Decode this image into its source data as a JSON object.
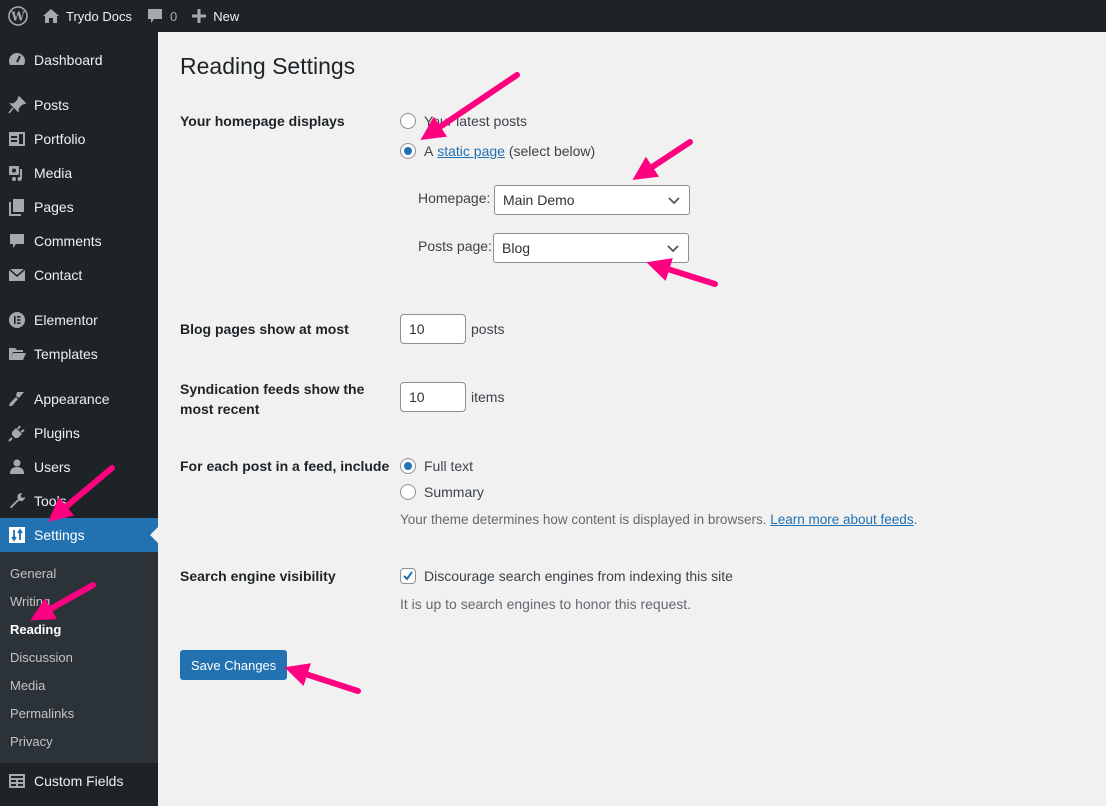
{
  "adminbar": {
    "wp_logo": "wordpress-logo",
    "site_name": "Trydo Docs",
    "comments_count": "0",
    "new_label": "New"
  },
  "sidebar": {
    "items": [
      {
        "label": "Dashboard",
        "icon": "dashboard-icon"
      },
      {
        "label": "Posts",
        "icon": "pin-icon"
      },
      {
        "label": "Portfolio",
        "icon": "portfolio-icon"
      },
      {
        "label": "Media",
        "icon": "media-icon"
      },
      {
        "label": "Pages",
        "icon": "pages-icon"
      },
      {
        "label": "Comments",
        "icon": "comment-icon"
      },
      {
        "label": "Contact",
        "icon": "envelope-icon"
      },
      {
        "label": "Elementor",
        "icon": "elementor-icon"
      },
      {
        "label": "Templates",
        "icon": "folder-icon"
      },
      {
        "label": "Appearance",
        "icon": "brush-icon"
      },
      {
        "label": "Plugins",
        "icon": "plug-icon"
      },
      {
        "label": "Users",
        "icon": "user-icon"
      },
      {
        "label": "Tools",
        "icon": "wrench-icon"
      },
      {
        "label": "Settings",
        "icon": "settings-icon"
      },
      {
        "label": "Custom Fields",
        "icon": "table-icon"
      }
    ],
    "submenu": [
      "General",
      "Writing",
      "Reading",
      "Discussion",
      "Media",
      "Permalinks",
      "Privacy"
    ],
    "current_submenu": "Reading"
  },
  "page": {
    "title": "Reading Settings",
    "homepage_displays": {
      "label": "Your homepage displays",
      "option_latest": "Your latest posts",
      "option_static_prefix": "A",
      "option_static_link": "static page",
      "option_static_suffix": "(select below)",
      "selected": "static",
      "homepage_label": "Homepage:",
      "homepage_value": "Main Demo",
      "posts_page_label": "Posts page:",
      "posts_page_value": "Blog"
    },
    "blog_pages": {
      "label": "Blog pages show at most",
      "value": "10",
      "unit": "posts"
    },
    "syndication": {
      "label_line1": "Syndication feeds show the",
      "label_line2": "most recent",
      "value": "10",
      "unit": "items"
    },
    "feed_include": {
      "label": "For each post in a feed, include",
      "option_full": "Full text",
      "option_summary": "Summary",
      "selected": "full",
      "description": "Your theme determines how content is displayed in browsers.",
      "link": "Learn more about feeds",
      "link_suffix": "."
    },
    "search_visibility": {
      "label": "Search engine visibility",
      "checkbox_label": "Discourage search engines from indexing this site",
      "checked": true,
      "description": "It is up to search engines to honor this request."
    },
    "save_button": "Save Changes"
  },
  "colors": {
    "accent": "#2271b1",
    "sidebar_bg": "#1d2327",
    "submenu_bg": "#2c3338",
    "annotation_arrow": "#ff0080"
  }
}
